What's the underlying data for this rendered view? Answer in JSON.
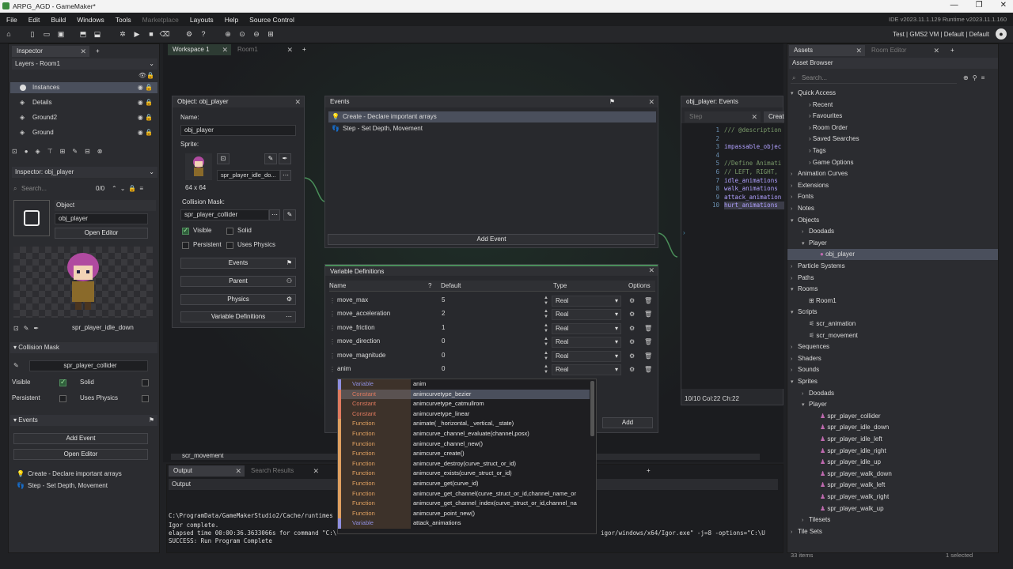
{
  "window": {
    "title": "ARPG_AGD - GameMaker*",
    "min": "—",
    "max": "❐",
    "close": "✕"
  },
  "menu": {
    "items": [
      "File",
      "Edit",
      "Build",
      "Windows",
      "Tools",
      "Marketplace",
      "Layouts",
      "Help",
      "Source Control"
    ],
    "version": "IDE v2023.11.1.129  Runtime v2023.11.1.160"
  },
  "toolbar": {
    "config": "Test | GMS2 VM | Default | Default"
  },
  "left": {
    "tabs": [
      "Inspector"
    ],
    "layers_title": "Layers - Room1",
    "layers": [
      "Instances",
      "Details",
      "Ground2",
      "Ground"
    ],
    "inspector_title": "Inspector: obj_player",
    "search_placeholder": "Search...",
    "count": "0/0",
    "object_label": "Object",
    "object_name": "obj_player",
    "open_editor": "Open Editor",
    "sprite_name": "spr_player_idle_down",
    "collision_section": "Collision Mask",
    "collision_value": "spr_player_collider",
    "visible": "Visible",
    "solid": "Solid",
    "persistent": "Persistent",
    "uses_physics": "Uses Physics",
    "events_section": "Events",
    "add_event": "Add Event",
    "open_editor2": "Open Editor",
    "events": [
      "Create - Declare important arrays",
      "Step - Set Depth, Movement"
    ]
  },
  "workspace": {
    "tabs": [
      "Workspace 1",
      "Room1"
    ],
    "object_panel": {
      "title": "Object: obj_player",
      "name_label": "Name:",
      "name": "obj_player",
      "sprite_label": "Sprite:",
      "sprite": "spr_player_idle_do...",
      "sprite_size": "64 x 64",
      "mask_label": "Collision Mask:",
      "mask": "spr_player_collider",
      "visible": "Visible",
      "solid": "Solid",
      "persistent": "Persistent",
      "uses_physics": "Uses Physics",
      "buttons": [
        "Events",
        "Parent",
        "Physics",
        "Variable Definitions"
      ]
    },
    "events_panel": {
      "title": "Events",
      "items": [
        "Create - Declare important arrays",
        "Step - Set Depth, Movement"
      ],
      "add": "Add Event"
    },
    "vardefs": {
      "title": "Variable Definitions",
      "headers": {
        "name": "Name",
        "default": "Default",
        "type": "Type",
        "options": "Options"
      },
      "rows": [
        {
          "name": "move_max",
          "default": "5",
          "type": "Real"
        },
        {
          "name": "move_acceleration",
          "default": "2",
          "type": "Real"
        },
        {
          "name": "move_friction",
          "default": "1",
          "type": "Real"
        },
        {
          "name": "move_direction",
          "default": "0",
          "type": "Real"
        },
        {
          "name": "move_magnitude",
          "default": "0",
          "type": "Real"
        },
        {
          "name": "anim",
          "default": "0",
          "type": "Real"
        }
      ],
      "add": "Add"
    },
    "code_panel": {
      "title": "obj_player: Events",
      "tabs": [
        "Step",
        "Creat"
      ],
      "lines": [
        "/// @description",
        "",
        "impassable_objec",
        "",
        "//Define Animati",
        "// LEFT, RIGHT,",
        "idle_animations",
        "walk_animations",
        "attack_animation",
        "hurt_animations"
      ],
      "line_numbers": [
        "1",
        "2",
        "3",
        "4",
        "5",
        "6",
        "7",
        "8",
        "9",
        "10"
      ],
      "status": "10/10 Col:22 Ch:22"
    },
    "script_tab": "scr_movement"
  },
  "autocomplete": [
    {
      "type": "Variable",
      "value": "anim"
    },
    {
      "type": "Constant",
      "value": "animcurvetype_bezier"
    },
    {
      "type": "Constant",
      "value": "animcurvetype_catmullrom"
    },
    {
      "type": "Constant",
      "value": "animcurvetype_linear"
    },
    {
      "type": "Function",
      "value": "animate( _horizontal, _vertical, _state)"
    },
    {
      "type": "Function",
      "value": "animcurve_channel_evaluate(channel,posx)"
    },
    {
      "type": "Function",
      "value": "animcurve_channel_new()"
    },
    {
      "type": "Function",
      "value": "animcurve_create()"
    },
    {
      "type": "Function",
      "value": "animcurve_destroy(curve_struct_or_id)"
    },
    {
      "type": "Function",
      "value": "animcurve_exists(curve_struct_or_id)"
    },
    {
      "type": "Function",
      "value": "animcurve_get(curve_id)"
    },
    {
      "type": "Function",
      "value": "animcurve_get_channel(curve_struct_or_id,channel_name_or"
    },
    {
      "type": "Function",
      "value": "animcurve_get_channel_index(curve_struct_or_id,channel_na"
    },
    {
      "type": "Function",
      "value": "animcurve_point_new()"
    },
    {
      "type": "Variable",
      "value": "attack_animations"
    }
  ],
  "output": {
    "tabs": [
      "Output",
      "Search Results"
    ],
    "sub": "Output",
    "lines": [
      "C:\\ProgramData/GameMakerStudio2/Cache/runtimes",
      "Igor complete.",
      "elapsed time 00:00:36.3633066s for command \"C:\\",
      "SUCCESS: Run Program Complete"
    ],
    "right_text": "igor/windows/x64/Igor.exe\"  -j=8  -options=\"C:\\U"
  },
  "assets": {
    "tabs": [
      "Assets",
      "Room Editor"
    ],
    "title": "Asset Browser",
    "search_placeholder": "Search...",
    "footer": "33 items",
    "footer_selected": "1 selected",
    "tree": [
      {
        "label": "Quick Access",
        "level": 0,
        "open": true,
        "folder": true
      },
      {
        "label": "Recent",
        "level": 1
      },
      {
        "label": "Favourites",
        "level": 1
      },
      {
        "label": "Room Order",
        "level": 1
      },
      {
        "label": "Saved Searches",
        "level": 1
      },
      {
        "label": "Tags",
        "level": 1
      },
      {
        "label": "Game Options",
        "level": 1
      },
      {
        "label": "Animation Curves",
        "level": 0,
        "folder": true
      },
      {
        "label": "Extensions",
        "level": 0,
        "folder": true
      },
      {
        "label": "Fonts",
        "level": 0,
        "folder": true
      },
      {
        "label": "Notes",
        "level": 0,
        "folder": true
      },
      {
        "label": "Objects",
        "level": 0,
        "open": true,
        "folder": true
      },
      {
        "label": "Doodads",
        "level": 1,
        "folder": true
      },
      {
        "label": "Player",
        "level": 1,
        "open": true,
        "folder": true
      },
      {
        "label": "obj_player",
        "level": 2,
        "selected": true
      },
      {
        "label": "Particle Systems",
        "level": 0,
        "folder": true
      },
      {
        "label": "Paths",
        "level": 0,
        "folder": true
      },
      {
        "label": "Rooms",
        "level": 0,
        "open": true,
        "folder": true
      },
      {
        "label": "Room1",
        "level": 1
      },
      {
        "label": "Scripts",
        "level": 0,
        "open": true,
        "folder": true
      },
      {
        "label": "scr_animation",
        "level": 1
      },
      {
        "label": "scr_movement",
        "level": 1
      },
      {
        "label": "Sequences",
        "level": 0,
        "folder": true
      },
      {
        "label": "Shaders",
        "level": 0,
        "folder": true
      },
      {
        "label": "Sounds",
        "level": 0,
        "folder": true
      },
      {
        "label": "Sprites",
        "level": 0,
        "open": true,
        "folder": true
      },
      {
        "label": "Doodads",
        "level": 1,
        "folder": true
      },
      {
        "label": "Player",
        "level": 1,
        "open": true,
        "folder": true
      },
      {
        "label": "spr_player_collider",
        "level": 2
      },
      {
        "label": "spr_player_idle_down",
        "level": 2
      },
      {
        "label": "spr_player_idle_left",
        "level": 2
      },
      {
        "label": "spr_player_idle_right",
        "level": 2
      },
      {
        "label": "spr_player_idle_up",
        "level": 2
      },
      {
        "label": "spr_player_walk_down",
        "level": 2
      },
      {
        "label": "spr_player_walk_left",
        "level": 2
      },
      {
        "label": "spr_player_walk_right",
        "level": 2
      },
      {
        "label": "spr_player_walk_up",
        "level": 2
      },
      {
        "label": "Tilesets",
        "level": 1,
        "folder": true
      },
      {
        "label": "Tile Sets",
        "level": 0,
        "folder": true
      }
    ]
  },
  "colors": {
    "accent": "#4a8f5a",
    "constant": "#e07a5f",
    "function": "#e0a060",
    "variable": "#8f8fe0"
  }
}
